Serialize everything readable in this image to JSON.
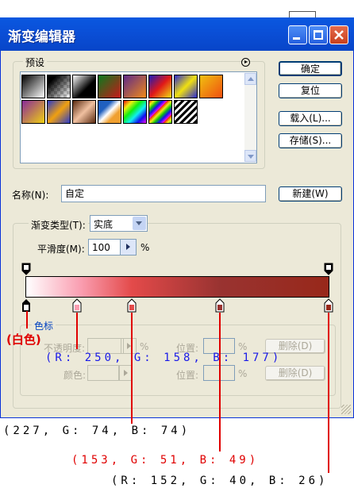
{
  "window": {
    "title": "渐变编辑器"
  },
  "presets": {
    "legend": "预设"
  },
  "buttons": {
    "ok": "确定",
    "reset": "复位",
    "load": "载入(L)...",
    "save": "存储(S)...",
    "new": "新建(W)"
  },
  "name": {
    "label": "名称(N):",
    "value": "自定"
  },
  "gradient": {
    "type_label": "渐变类型(T):",
    "type_value": "实底",
    "smooth_label": "平滑度(M):",
    "smooth_value": "100",
    "smooth_unit": "%"
  },
  "stops": {
    "legend": "色标",
    "opacity_label": "不透明度:",
    "opacity_unit": "%",
    "location_label": "位置:",
    "location_unit": "%",
    "delete_label": "删除(D)",
    "color_label": "颜色:"
  },
  "annotations": {
    "white": "白色",
    "rgb1": "(R: 250, G: 158, B: 177)",
    "rgb2": "(227, G: 74, B: 74)",
    "rgb3": "(153, G: 51, B: 49)",
    "rgb4": "(R: 152, G: 40, B: 26)"
  },
  "colors": {
    "stop_white": "#ffffff",
    "stop_pink": "#fa9eb1",
    "stop_red": "#e34a4a",
    "stop_dark": "#993331",
    "stop_darkest": "#98281a",
    "annotation_line": "#e00000",
    "annotation_blue": "#1a1ae8"
  }
}
